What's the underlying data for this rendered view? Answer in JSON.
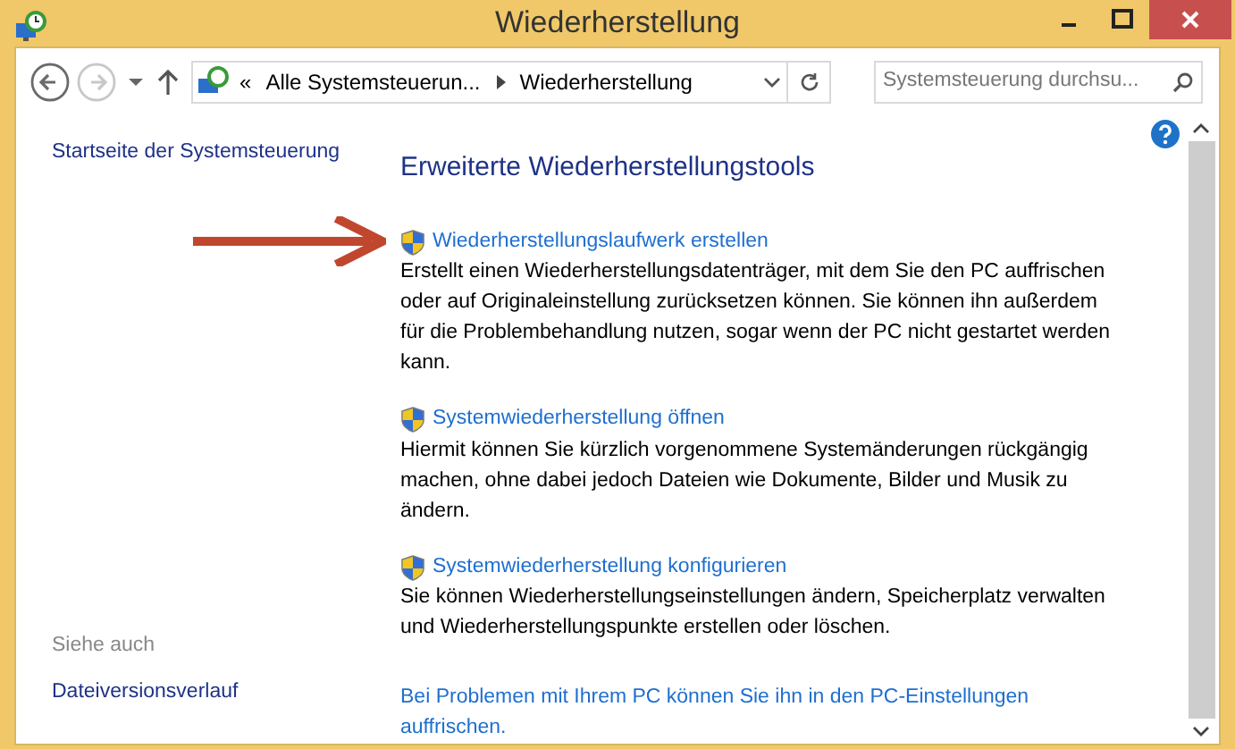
{
  "window": {
    "title": "Wiederherstellung"
  },
  "nav_buttons": [
    {
      "kind": "back",
      "disabled": false
    },
    {
      "kind": "forward",
      "disabled": true
    }
  ],
  "address_bar": {
    "crumbs": [
      "«",
      "Alle Systemsteuerun...",
      "Wiederherstellung"
    ]
  },
  "search": {
    "placeholder": "Systemsteuerung durchsu..."
  },
  "sidebar": {
    "items": [
      "Startseite der Systemsteuerung"
    ],
    "see_also_heading": "Siehe auch",
    "see_also": [
      "Dateiversionsverlauf"
    ]
  },
  "main": {
    "heading": "Erweiterte Wiederherstellungstools",
    "tasks": [
      {
        "title": "Wiederherstellungslaufwerk erstellen",
        "description": "Erstellt einen Wiederherstellungsdatenträger, mit dem Sie den PC auffrischen oder auf Originaleinstellung zurücksetzen können. Sie können ihn außerdem für die Problembehandlung nutzen, sogar wenn der PC nicht gestartet werden kann.",
        "highlighted": true
      },
      {
        "title": "Systemwiederherstellung öffnen",
        "description": "Hiermit können Sie kürzlich vorgenommene Systemänderungen rückgängig machen, ohne dabei jedoch Dateien wie Dokumente, Bilder und Musik zu ändern.",
        "highlighted": false
      },
      {
        "title": "Systemwiederherstellung konfigurieren",
        "description": "Sie können Wiederherstellungseinstellungen ändern, Speicherplatz verwalten und Wiederherstellungspunkte erstellen oder löschen.",
        "highlighted": false
      }
    ],
    "footer_link": "Bei Problemen mit Ihrem PC können Sie ihn in den PC-Einstellungen auffrischen."
  }
}
